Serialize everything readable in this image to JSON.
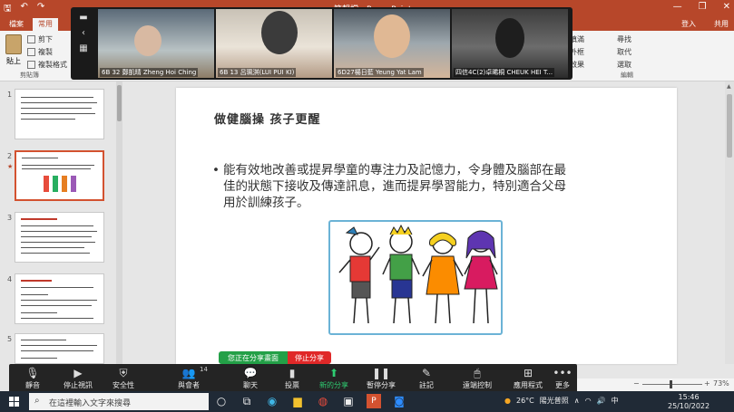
{
  "window": {
    "doc_title": "簡報檔 - PowerPoint",
    "sign_in": "登入",
    "share": "共用"
  },
  "ribbon": {
    "tabs": [
      "檔案",
      "常用"
    ],
    "paste": "貼上",
    "cut": "剪下",
    "copy": "複製",
    "format_painter": "複製格式",
    "clipboard_label": "剪貼簿",
    "find": "尋找",
    "replace": "取代",
    "select": "選取",
    "shape_fill": "圖案填滿",
    "shape_outline": "圖案外框",
    "shape_effects": "圖案效果",
    "editing_label": "編輯"
  },
  "zoom_tiles": [
    {
      "name": "6B 32 鄭凱晴 Zheng Hoi Ching"
    },
    {
      "name": "6B 13 呂珮淇(LUI PUI KI)"
    },
    {
      "name": "6D27楊日藍 Yeung Yat Lam"
    },
    {
      "name": "四信4C(2)卓晞桐 CHEUK HEI T..."
    }
  ],
  "slides_panel": [
    {
      "num": "1"
    },
    {
      "num": "2"
    },
    {
      "num": "3"
    },
    {
      "num": "4"
    },
    {
      "num": "5"
    }
  ],
  "slide": {
    "title": "做健腦操 孩子更醒",
    "bullet_line1": "能有效地改善或提昇學童的專注力及記憶力，令身體及腦部在最",
    "bullet_line2": "佳的狀態下接收及傳達訊息，進而提昇學習能力，特別適合父母",
    "bullet_line3": "用於訓練孩子。"
  },
  "share_bar": {
    "sharing": "您正在分享畫面",
    "stop": "停止分享"
  },
  "zoom_toolbar": {
    "mute": "靜音",
    "stop_video": "停止視訊",
    "security": "安全性",
    "participants": "與會者",
    "participant_count": "14",
    "chat": "聊天",
    "polls": "投票",
    "new_share": "新的分享",
    "pause_share": "暫停分享",
    "annotate": "註記",
    "remote_control": "遠端控制",
    "apps": "應用程式",
    "more": "更多"
  },
  "status": {
    "zoom_pct": "73%"
  },
  "taskbar": {
    "search_placeholder": "在這裡輸入文字來搜尋",
    "temperature": "26°C",
    "weather": "陽光普照",
    "ime": "中",
    "time": "15:46",
    "date": "25/10/2022"
  },
  "colors": {
    "ppt_red": "#b7472a",
    "share_green": "#23a047",
    "stop_red": "#e02828"
  }
}
